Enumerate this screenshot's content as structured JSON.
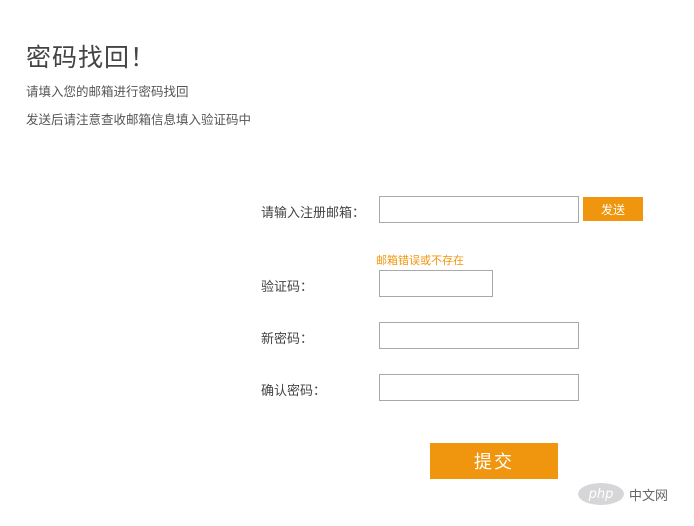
{
  "header": {
    "title": "密码找回！",
    "line1": "请填入您的邮箱进行密码找回",
    "line2": "发送后请注意查收邮箱信息填入验证码中"
  },
  "form": {
    "email_label": "请输入注册邮箱：",
    "email_value": "",
    "send_label": "发送",
    "email_error": "邮箱错误或不存在",
    "code_label": "验证码：",
    "code_value": "",
    "new_password_label": "新密码：",
    "new_password_value": "",
    "confirm_password_label": "确认密码：",
    "confirm_password_value": "",
    "submit_label": "提交"
  },
  "watermark": {
    "logo_text": "php",
    "site_text": "中文网"
  },
  "colors": {
    "accent": "#f0960e",
    "border": "#a9a9a9",
    "text": "#444444"
  }
}
